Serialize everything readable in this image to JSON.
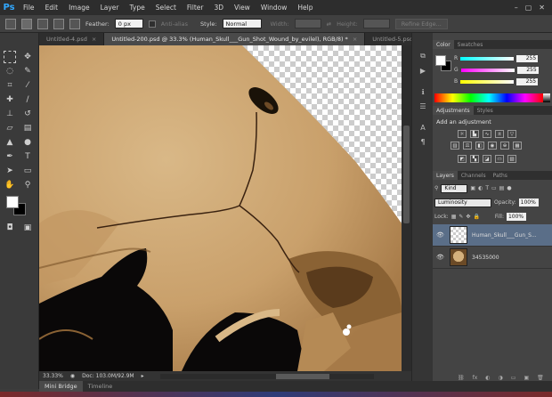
{
  "menu": {
    "logo": "Ps",
    "items": [
      "File",
      "Edit",
      "Image",
      "Layer",
      "Type",
      "Select",
      "Filter",
      "3D",
      "View",
      "Window",
      "Help"
    ],
    "controls": [
      "–",
      "▢",
      "✕"
    ]
  },
  "options": {
    "feather_label": "Feather:",
    "feather_value": "0 px",
    "antialias_label": "Anti-alias",
    "style_label": "Style:",
    "style_value": "Normal",
    "width_label": "Width:",
    "height_label": "Height:",
    "refine_edge_label": "Refine Edge..."
  },
  "tabs": [
    {
      "label": "Untitled-4.psd",
      "close": "×"
    },
    {
      "label": "Untitled-200.psd @ 33.3% (Human_Skull___Gun_Shot_Wound_by_evilel), RGB/8) *",
      "close": "×"
    },
    {
      "label": "Untitled-5.psd",
      "close": "×"
    }
  ],
  "status": {
    "zoom": "33.33%",
    "doc": "Doc: 103.0M/92.9M"
  },
  "bottom_tabs": [
    "Mini Bridge",
    "Timeline"
  ],
  "color_panel": {
    "tabs": [
      "Color",
      "Swatches"
    ],
    "fg_color": "#ffffff",
    "bg_color": "#000000",
    "rows": [
      {
        "label": "R",
        "value": "255",
        "grad": "linear-gradient(90deg,#0ff,#fff)"
      },
      {
        "label": "G",
        "value": "255",
        "grad": "linear-gradient(90deg,#f0f,#fff)"
      },
      {
        "label": "B",
        "value": "255",
        "grad": "linear-gradient(90deg,#ff0,#fff)"
      }
    ]
  },
  "adjustments_panel": {
    "tabs": [
      "Adjustments",
      "Styles"
    ],
    "title": "Add an adjustment"
  },
  "layers_panel": {
    "tabs": [
      "Layers",
      "Channels",
      "Paths"
    ],
    "kind_label": "Kind",
    "blend_mode": "Luminosity",
    "opacity_label": "Opacity:",
    "opacity_value": "100%",
    "lock_label": "Lock:",
    "fill_label": "Fill:",
    "fill_value": "100%",
    "layers": [
      {
        "name": "Human_Skull___Gun_S...",
        "visible_icon": "👁",
        "active": true
      },
      {
        "name": "34535000",
        "visible_icon": "👁",
        "active": false
      }
    ],
    "bottom_icons": [
      "⛓",
      "fx",
      "◐",
      "◑",
      "▭",
      "▣",
      "🗑"
    ]
  }
}
